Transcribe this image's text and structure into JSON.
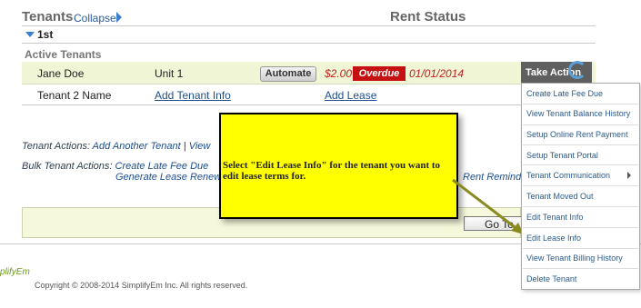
{
  "header": {
    "tenants": "Tenants",
    "collapse": "Collapse",
    "rent_status": "Rent Status"
  },
  "unit_group": {
    "name": "1st",
    "active_label": "Active Tenants"
  },
  "tenants": [
    {
      "name": "Jane Doe",
      "unit": "Unit 1",
      "automate": "Automate",
      "amount": "$2.00",
      "status": "Overdue on",
      "date": "01/01/2014",
      "take_action": "Take Action"
    },
    {
      "name": "Tenant 2 Name",
      "add_info": "Add Tenant Info",
      "add_lease": "Add Lease"
    }
  ],
  "tenant_actions": {
    "label": "Tenant Actions:",
    "add_another": "Add Another Tenant",
    "sep": "|",
    "view": "View"
  },
  "bulk_actions": {
    "label": "Bulk Tenant Actions:",
    "create_late_fee": "Create Late Fee Due",
    "sep": "|",
    "generate_renewal": "Generate Lease Renew",
    "sep2": "|",
    "rent_reminder": "Rent Reminde"
  },
  "goto_button": "Go To",
  "callout_text": "Select \"Edit Lease Info\" for the tenant you want to edit lease terms for.",
  "dropdown_menu": [
    "Create Late Fee Due",
    "View Tenant Balance History",
    "Setup Online Rent Payment",
    "Setup Tenant Portal",
    "Tenant Communication",
    "Tenant Moved Out",
    "Edit Tenant Info",
    "Edit Lease Info",
    "View Tenant Billing History",
    "Delete Tenant"
  ],
  "footer": {
    "logo": "plifyEm",
    "copyright": "Copyright © 2008-2014 SimplifyEm Inc. All rights reserved."
  },
  "colors": {
    "overdue_bg": "#c51111",
    "callout_bg": "#ffff00",
    "arrow": "#8a8a20",
    "row_highlight": "#f0f5d6"
  }
}
